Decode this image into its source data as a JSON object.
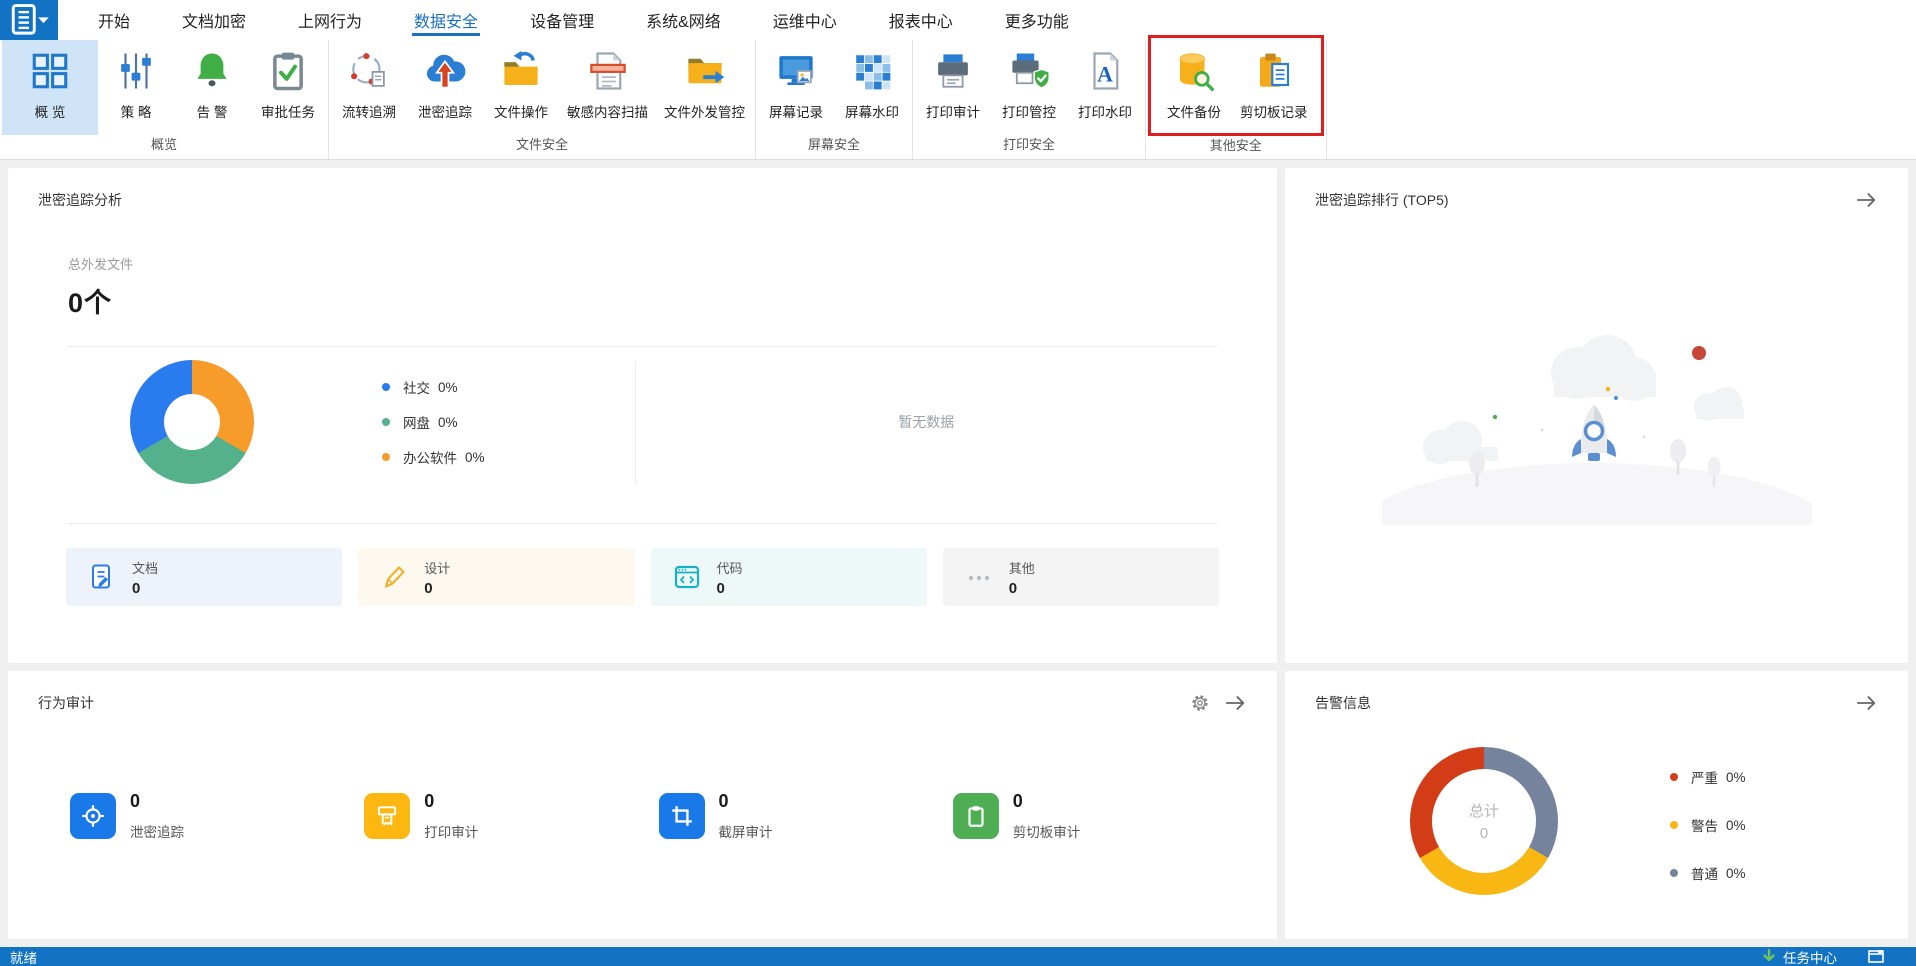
{
  "colors": {
    "app_blue": "#1273c4",
    "active_tab_blue": "#1a6fc0",
    "ribbon_selected_bg": "#cfe4f6",
    "highlight_box_red": "#e11e1e",
    "content_bg": "#f0f0f1"
  },
  "menubar": {
    "tabs": [
      {
        "label": "开始"
      },
      {
        "label": "文档加密"
      },
      {
        "label": "上网行为"
      },
      {
        "label": "数据安全",
        "active": true
      },
      {
        "label": "设备管理"
      },
      {
        "label": "系统&网络"
      },
      {
        "label": "运维中心"
      },
      {
        "label": "报表中心"
      },
      {
        "label": "更多功能"
      }
    ]
  },
  "ribbon": {
    "groups": [
      {
        "label": "概览",
        "items": [
          {
            "label": "概 览",
            "icon": "overview-grid-icon",
            "selected": true
          },
          {
            "label": "策 略",
            "icon": "policy-sliders-icon"
          },
          {
            "label": "告 警",
            "icon": "alert-bell-icon"
          },
          {
            "label": "审批任务",
            "icon": "approval-clipboard-icon"
          }
        ]
      },
      {
        "label": "文件安全",
        "items": [
          {
            "label": "流转追溯",
            "icon": "circulation-trace-icon"
          },
          {
            "label": "泄密追踪",
            "icon": "leak-cloud-icon"
          },
          {
            "label": "文件操作",
            "icon": "file-operation-folder-icon"
          },
          {
            "label": "敏感内容扫描",
            "icon": "sensitive-scan-icon"
          },
          {
            "label": "文件外发管控",
            "icon": "file-outgoing-folder-icon"
          }
        ]
      },
      {
        "label": "屏幕安全",
        "items": [
          {
            "label": "屏幕记录",
            "icon": "screen-record-icon"
          },
          {
            "label": "屏幕水印",
            "icon": "screen-watermark-icon"
          }
        ]
      },
      {
        "label": "打印安全",
        "items": [
          {
            "label": "打印审计",
            "icon": "print-audit-icon"
          },
          {
            "label": "打印管控",
            "icon": "print-control-icon"
          },
          {
            "label": "打印水印",
            "icon": "print-watermark-icon"
          }
        ]
      },
      {
        "label": "其他安全",
        "highlighted_red_box": true,
        "items": [
          {
            "label": "文件备份",
            "icon": "file-backup-icon"
          },
          {
            "label": "剪切板记录",
            "icon": "clipboard-record-icon"
          }
        ]
      }
    ]
  },
  "panels": {
    "trace_analysis": {
      "title": "泄密追踪分析",
      "total_label": "总外发文件",
      "total_value": "0个",
      "empty_text": "暂无数据",
      "legend": [
        {
          "label": "社交",
          "value": "0%",
          "color": "#2a7bee"
        },
        {
          "label": "网盘",
          "value": "0%",
          "color": "#55b08c"
        },
        {
          "label": "办公软件",
          "value": "0%",
          "color": "#f79b2b"
        }
      ],
      "categories": [
        {
          "label": "文档",
          "value": "0"
        },
        {
          "label": "设计",
          "value": "0"
        },
        {
          "label": "代码",
          "value": "0"
        },
        {
          "label": "其他",
          "value": "0"
        }
      ]
    },
    "trace_rank": {
      "title": "泄密追踪排行 (TOP5)"
    },
    "behavior_audit": {
      "title": "行为审计",
      "stats": [
        {
          "label": "泄密追踪",
          "value": "0",
          "color": "#1a79e9"
        },
        {
          "label": "打印审计",
          "value": "0",
          "color": "#fcb811"
        },
        {
          "label": "截屏审计",
          "value": "0",
          "color": "#1a79e9"
        },
        {
          "label": "剪切板审计",
          "value": "0",
          "color": "#4fae54"
        }
      ]
    },
    "alerts": {
      "title": "告警信息",
      "center_label": "总计",
      "center_value": "0",
      "legend": [
        {
          "label": "严重",
          "value": "0%",
          "color": "#d23d18"
        },
        {
          "label": "警告",
          "value": "0%",
          "color": "#f8b712"
        },
        {
          "label": "普通",
          "value": "0%",
          "color": "#75849c"
        }
      ]
    }
  },
  "chart_data": [
    {
      "type": "pie",
      "title": "泄密追踪分析",
      "labels": [
        "社交",
        "网盘",
        "办公软件"
      ],
      "values_pct": [
        0,
        0,
        0
      ],
      "colors": [
        "#2a7bee",
        "#55b08c",
        "#f79b2b"
      ],
      "donut": true,
      "legend_position": "right"
    },
    {
      "type": "pie",
      "title": "告警信息",
      "labels": [
        "严重",
        "警告",
        "普通"
      ],
      "values_pct": [
        0,
        0,
        0
      ],
      "colors": [
        "#d23d18",
        "#f8b712",
        "#75849c"
      ],
      "donut": true,
      "center_label": "总计",
      "center_value": 0,
      "legend_position": "right"
    }
  ],
  "statusbar": {
    "ready": "就绪",
    "task_center": "任务中心"
  }
}
